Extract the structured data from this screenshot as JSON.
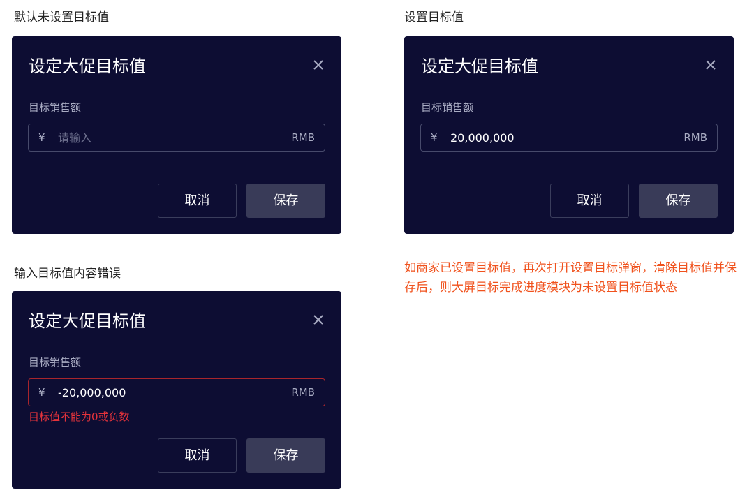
{
  "sections": [
    {
      "caption": "默认未设置目标值",
      "dialog": {
        "title": "设定大促目标值",
        "field_label": "目标销售额",
        "currency_symbol": "¥",
        "value": "",
        "placeholder": "请输入",
        "unit": "RMB",
        "error": "",
        "cancel_label": "取消",
        "save_label": "保存"
      }
    },
    {
      "caption": "设置目标值",
      "dialog": {
        "title": "设定大促目标值",
        "field_label": "目标销售额",
        "currency_symbol": "¥",
        "value": "20,000,000",
        "placeholder": "",
        "unit": "RMB",
        "error": "",
        "cancel_label": "取消",
        "save_label": "保存"
      }
    },
    {
      "caption": "输入目标值内容错误",
      "dialog": {
        "title": "设定大促目标值",
        "field_label": "目标销售额",
        "currency_symbol": "¥",
        "value": "-20,000,000",
        "placeholder": "",
        "unit": "RMB",
        "error": "目标值不能为0或负数",
        "cancel_label": "取消",
        "save_label": "保存"
      }
    }
  ],
  "note": "如商家已设置目标值，再次打开设置目标弹窗，清除目标值并保存后，则大屏目标完成进度模块为未设置目标值状态",
  "colors": {
    "dialog_bg": "#0d0d33",
    "button_save_bg": "#393b58",
    "error": "#e5333b",
    "note": "#f0521d"
  },
  "icons": {
    "close": "close-icon"
  }
}
